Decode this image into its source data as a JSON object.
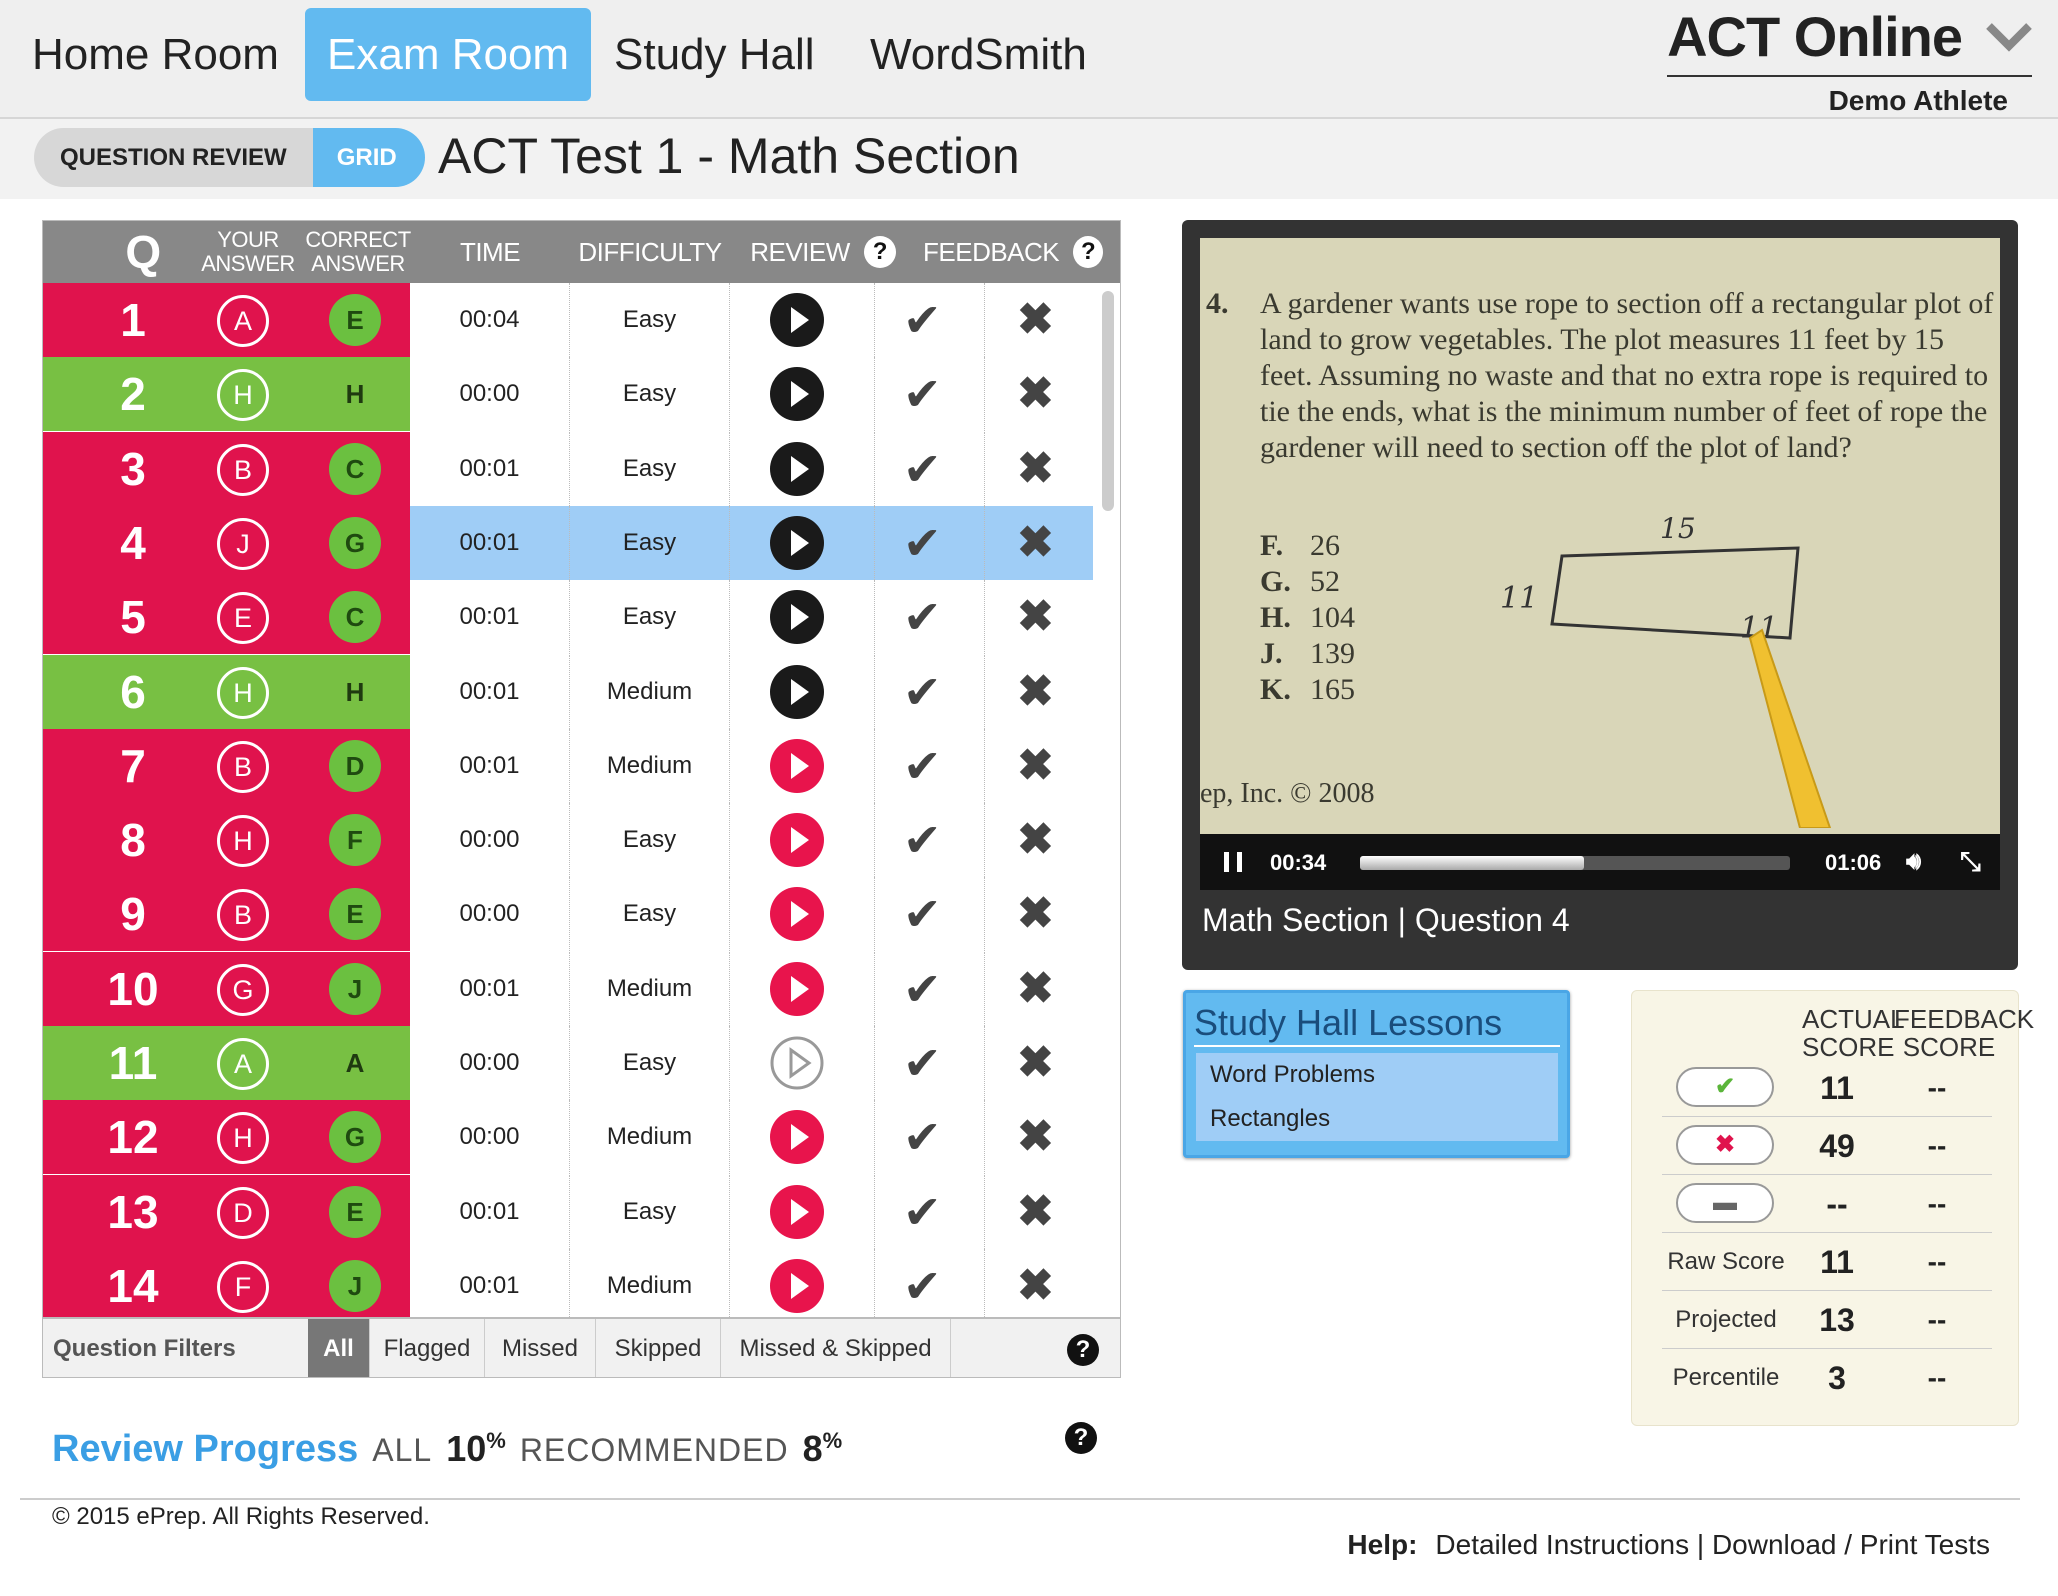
{
  "nav": {
    "items": [
      "Home Room",
      "Exam Room",
      "Study Hall",
      "WordSmith"
    ],
    "active": "Exam Room"
  },
  "brand": {
    "title": "ACT Online",
    "user": "Demo Athlete"
  },
  "view_toggle": {
    "question_review": "QUESTION REVIEW",
    "grid": "GRID"
  },
  "page_title": "ACT Test 1 - Math Section",
  "table": {
    "headers": {
      "q": "Q",
      "your_answer": [
        "YOUR",
        "ANSWER"
      ],
      "correct_answer": [
        "CORRECT",
        "ANSWER"
      ],
      "time": "TIME",
      "difficulty": "DIFFICULTY",
      "review": "REVIEW",
      "feedback": "FEEDBACK",
      "help": "?"
    },
    "rows": [
      {
        "q": "1",
        "your": "A",
        "correct": "E",
        "time": "00:04",
        "difficulty": "Easy",
        "status": "wrong",
        "review": "black",
        "selected": false
      },
      {
        "q": "2",
        "your": "H",
        "correct": "H",
        "time": "00:00",
        "difficulty": "Easy",
        "status": "right",
        "review": "black",
        "selected": false
      },
      {
        "q": "3",
        "your": "B",
        "correct": "C",
        "time": "00:01",
        "difficulty": "Easy",
        "status": "wrong",
        "review": "black",
        "selected": false
      },
      {
        "q": "4",
        "your": "J",
        "correct": "G",
        "time": "00:01",
        "difficulty": "Easy",
        "status": "wrong",
        "review": "black",
        "selected": true
      },
      {
        "q": "5",
        "your": "E",
        "correct": "C",
        "time": "00:01",
        "difficulty": "Easy",
        "status": "wrong",
        "review": "black",
        "selected": false
      },
      {
        "q": "6",
        "your": "H",
        "correct": "H",
        "time": "00:01",
        "difficulty": "Medium",
        "status": "right",
        "review": "black",
        "selected": false
      },
      {
        "q": "7",
        "your": "B",
        "correct": "D",
        "time": "00:01",
        "difficulty": "Medium",
        "status": "wrong",
        "review": "red",
        "selected": false
      },
      {
        "q": "8",
        "your": "H",
        "correct": "F",
        "time": "00:00",
        "difficulty": "Easy",
        "status": "wrong",
        "review": "red",
        "selected": false
      },
      {
        "q": "9",
        "your": "B",
        "correct": "E",
        "time": "00:00",
        "difficulty": "Easy",
        "status": "wrong",
        "review": "red",
        "selected": false
      },
      {
        "q": "10",
        "your": "G",
        "correct": "J",
        "time": "00:01",
        "difficulty": "Medium",
        "status": "wrong",
        "review": "red",
        "selected": false
      },
      {
        "q": "11",
        "your": "A",
        "correct": "A",
        "time": "00:00",
        "difficulty": "Easy",
        "status": "right",
        "review": "grey",
        "selected": false
      },
      {
        "q": "12",
        "your": "H",
        "correct": "G",
        "time": "00:00",
        "difficulty": "Medium",
        "status": "wrong",
        "review": "red",
        "selected": false
      },
      {
        "q": "13",
        "your": "D",
        "correct": "E",
        "time": "00:01",
        "difficulty": "Easy",
        "status": "wrong",
        "review": "red",
        "selected": false
      },
      {
        "q": "14",
        "your": "F",
        "correct": "J",
        "time": "00:01",
        "difficulty": "Medium",
        "status": "wrong",
        "review": "red",
        "selected": false
      }
    ]
  },
  "filters": {
    "label": "Question Filters",
    "items": [
      "All",
      "Flagged",
      "Missed",
      "Skipped",
      "Missed & Skipped"
    ],
    "active": "All",
    "help": "?"
  },
  "review_progress": {
    "label": "Review Progress",
    "all_label": "ALL",
    "all_value": "10",
    "recommended_label": "RECOMMENDED",
    "recommended_value": "8",
    "unit": "%",
    "help": "?"
  },
  "video": {
    "problem_number": "4.",
    "problem_text": "A gardener wants use rope to section off a rectangular plot of land to grow vegetables. The plot measures 11 feet by 15 feet. Assuming no waste and that no extra rope is required to tie the ends, what is the minimum number of feet of rope the gardener will need to section off the plot of land?",
    "options": [
      {
        "letter": "F.",
        "value": "26"
      },
      {
        "letter": "G.",
        "value": "52"
      },
      {
        "letter": "H.",
        "value": "104"
      },
      {
        "letter": "J.",
        "value": "139"
      },
      {
        "letter": "K.",
        "value": "165"
      }
    ],
    "sketch_top": "15",
    "sketch_left": "11",
    "sketch_right": "11",
    "copyright": "ep, Inc. © 2008",
    "current_time": "00:34",
    "duration": "01:06",
    "progress": 0.52,
    "caption": "Math Section | Question 4"
  },
  "study_hall": {
    "title": "Study Hall Lessons",
    "lessons": [
      "Word Problems",
      "Rectangles"
    ]
  },
  "scores": {
    "headers": {
      "actual": [
        "ACTUAL",
        "SCORE"
      ],
      "feedback": [
        "FEEDBACK",
        "SCORE"
      ]
    },
    "rows": [
      {
        "label": "",
        "icon": "check",
        "actual": "11",
        "feedback": "--"
      },
      {
        "label": "",
        "icon": "x",
        "actual": "49",
        "feedback": "--"
      },
      {
        "label": "",
        "icon": "minus",
        "actual": "--",
        "feedback": "--"
      },
      {
        "label": "Raw Score",
        "icon": "",
        "actual": "11",
        "feedback": "--"
      },
      {
        "label": "Projected",
        "icon": "",
        "actual": "13",
        "feedback": "--"
      },
      {
        "label": "Percentile",
        "icon": "",
        "actual": "3",
        "feedback": "--"
      }
    ]
  },
  "footer": {
    "copyright": "© 2015 ePrep. All Rights Reserved.",
    "help_label": "Help:",
    "links": [
      "Detailed Instructions",
      "Download / Print Tests"
    ],
    "separator": "|"
  },
  "colors": {
    "wrong": "#e0134d",
    "right": "#78c043",
    "accent": "#62baf0",
    "selected": "#9fcdf6"
  }
}
